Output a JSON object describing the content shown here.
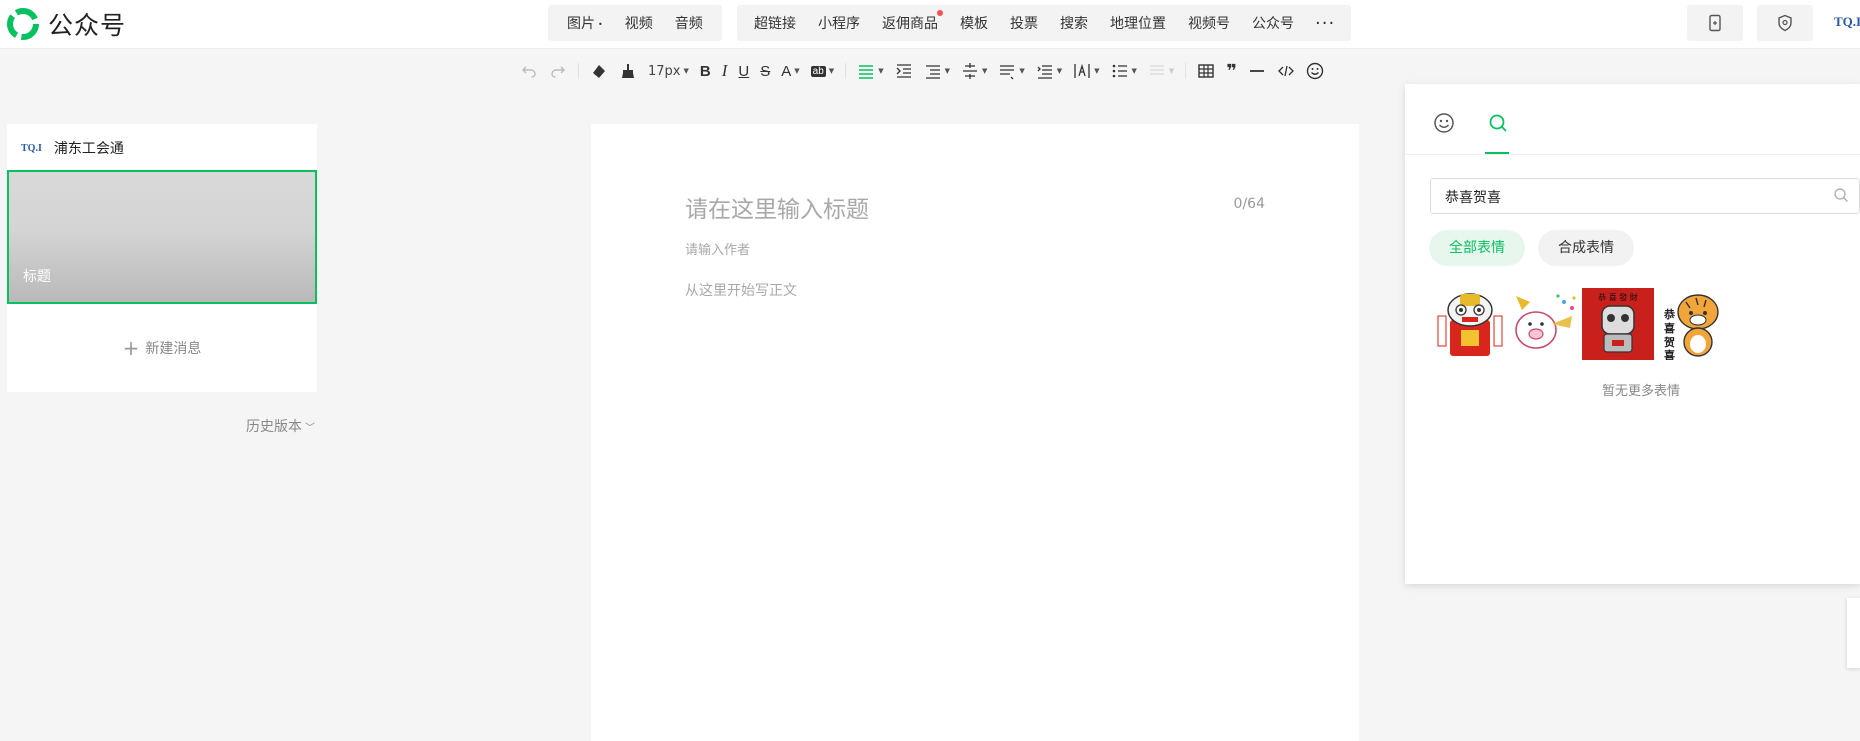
{
  "app": {
    "logo_text": "公众号"
  },
  "topbar": {
    "media": [
      {
        "label": "图片",
        "has_caret": true
      },
      {
        "label": "视频"
      },
      {
        "label": "音频"
      }
    ],
    "insert": [
      {
        "label": "超链接"
      },
      {
        "label": "小程序"
      },
      {
        "label": "返佣商品",
        "badge": true
      },
      {
        "label": "模板"
      },
      {
        "label": "投票"
      },
      {
        "label": "搜索"
      },
      {
        "label": "地理位置"
      },
      {
        "label": "视频号"
      },
      {
        "label": "公众号"
      }
    ],
    "more": "···",
    "right_logo": "TQ.I"
  },
  "toolbar": {
    "font_size": "17px",
    "bold": "B",
    "italic": "I",
    "underline": "U",
    "strike": "S",
    "font_color": "A",
    "bg_color": "ab",
    "quote": "❞"
  },
  "left": {
    "account_logo": "TQ.I",
    "account_name": "浦东工会通",
    "cover_title": "标题",
    "new_message": "新建消息",
    "history": "历史版本"
  },
  "editor": {
    "title_placeholder": "请在这里输入标题",
    "counter": "0/64",
    "author_placeholder": "请输入作者",
    "body_placeholder": "从这里开始写正文"
  },
  "sticker_panel": {
    "search_value": "恭喜贺喜",
    "chips": [
      "全部表情",
      "合成表情"
    ],
    "stickers": [
      "lion-dance-sticker",
      "pig-party-sticker",
      "robot-red-sticker",
      "tiger-gongxi-sticker"
    ],
    "no_more": "暂无更多表情"
  },
  "colors": {
    "accent": "#07c160",
    "badge": "#fa5151"
  }
}
